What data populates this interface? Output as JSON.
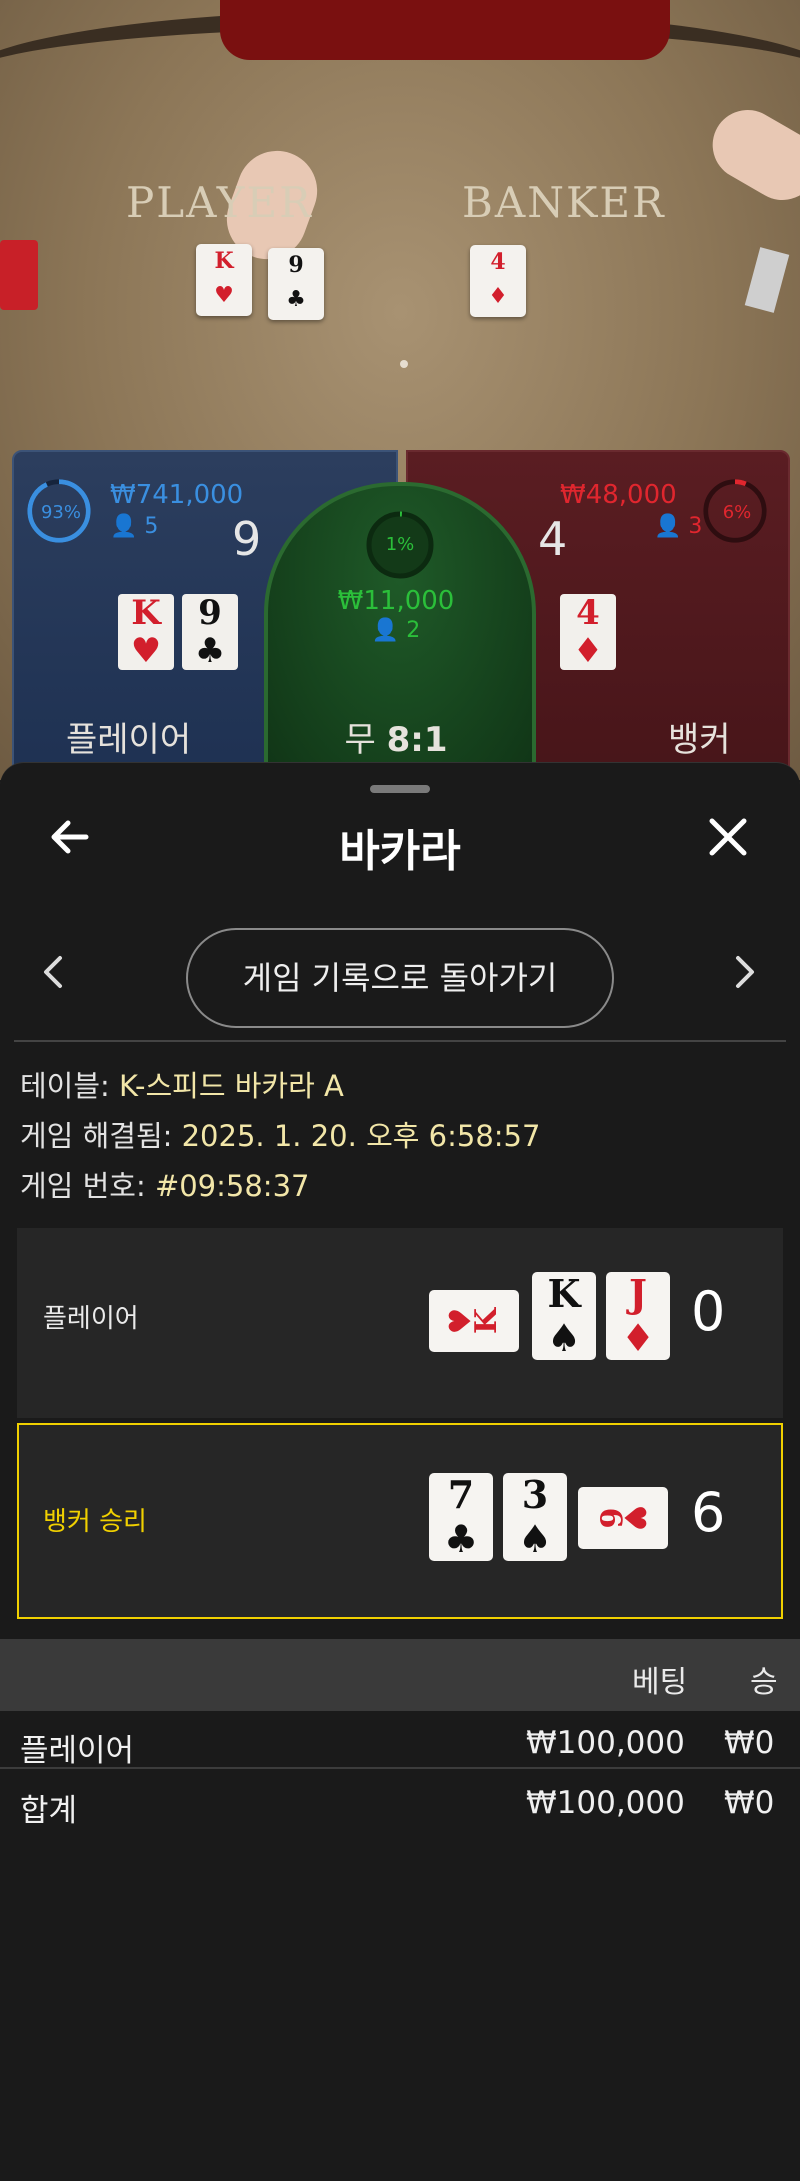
{
  "video": {
    "felt_player": "PLAYER",
    "felt_banker": "BANKER",
    "player_cards": [
      {
        "rank": "K",
        "suit": "♥",
        "color": "red"
      },
      {
        "rank": "9",
        "suit": "♣",
        "color": "black"
      }
    ],
    "banker_cards": [
      {
        "rank": "4",
        "suit": "♦",
        "color": "red"
      }
    ]
  },
  "bet_board": {
    "player": {
      "percent": "93%",
      "percent_value": 0.93,
      "amount": "₩741,000",
      "count": "5",
      "score": "9",
      "label": "플레이어",
      "cards": [
        {
          "rank": "K",
          "suit": "♥",
          "color": "red"
        },
        {
          "rank": "9",
          "suit": "♣",
          "color": "black"
        }
      ]
    },
    "tie": {
      "percent": "1%",
      "percent_value": 0.01,
      "amount": "₩11,000",
      "count": "2",
      "label": "무",
      "payout": "8:1"
    },
    "banker": {
      "percent": "6%",
      "percent_value": 0.06,
      "amount": "₩48,000",
      "count": "3",
      "score": "4",
      "label": "뱅커",
      "cards": [
        {
          "rank": "4",
          "suit": "♦",
          "color": "red"
        }
      ]
    }
  },
  "header": {
    "title": "바카라",
    "back_icon": "arrow-left-icon",
    "close_icon": "close-icon"
  },
  "nav": {
    "back_to_history": "게임 기록으로 돌아가기",
    "prev_icon": "chevron-left-icon",
    "next_icon": "chevron-right-icon"
  },
  "info": {
    "table_label": "테이블:",
    "table_value": "K-스피드 바카라 A",
    "resolved_label": "게임 해결됨:",
    "resolved_value": "2025. 1. 20. 오후 6:58:57",
    "round_label": "게임 번호:",
    "round_value": "#09:58:37"
  },
  "results": [
    {
      "label": "플레이어",
      "score": "0",
      "highlight": false,
      "cards": [
        {
          "rank": "K",
          "suit": "♥",
          "color": "red",
          "sideways": true
        },
        {
          "rank": "K",
          "suit": "♠",
          "color": "black"
        },
        {
          "rank": "J",
          "suit": "♦",
          "color": "red"
        }
      ]
    },
    {
      "label": "뱅커 승리",
      "score": "6",
      "highlight": true,
      "cards": [
        {
          "rank": "7",
          "suit": "♣",
          "color": "black"
        },
        {
          "rank": "3",
          "suit": "♠",
          "color": "black"
        },
        {
          "rank": "6",
          "suit": "♥",
          "color": "red",
          "sideways": true
        }
      ]
    }
  ],
  "bets_table": {
    "headers": {
      "bet": "베팅",
      "win": "승"
    },
    "rows": [
      {
        "name": "플레이어",
        "bet": "₩100,000",
        "win": "₩0"
      }
    ],
    "total": {
      "name": "합계",
      "bet": "₩100,000",
      "win": "₩0"
    }
  },
  "colors": {
    "accent_gold": "#f0d000",
    "player_blue": "#3a8fe0",
    "banker_red": "#e0262e",
    "tie_green": "#2bbf3a"
  }
}
